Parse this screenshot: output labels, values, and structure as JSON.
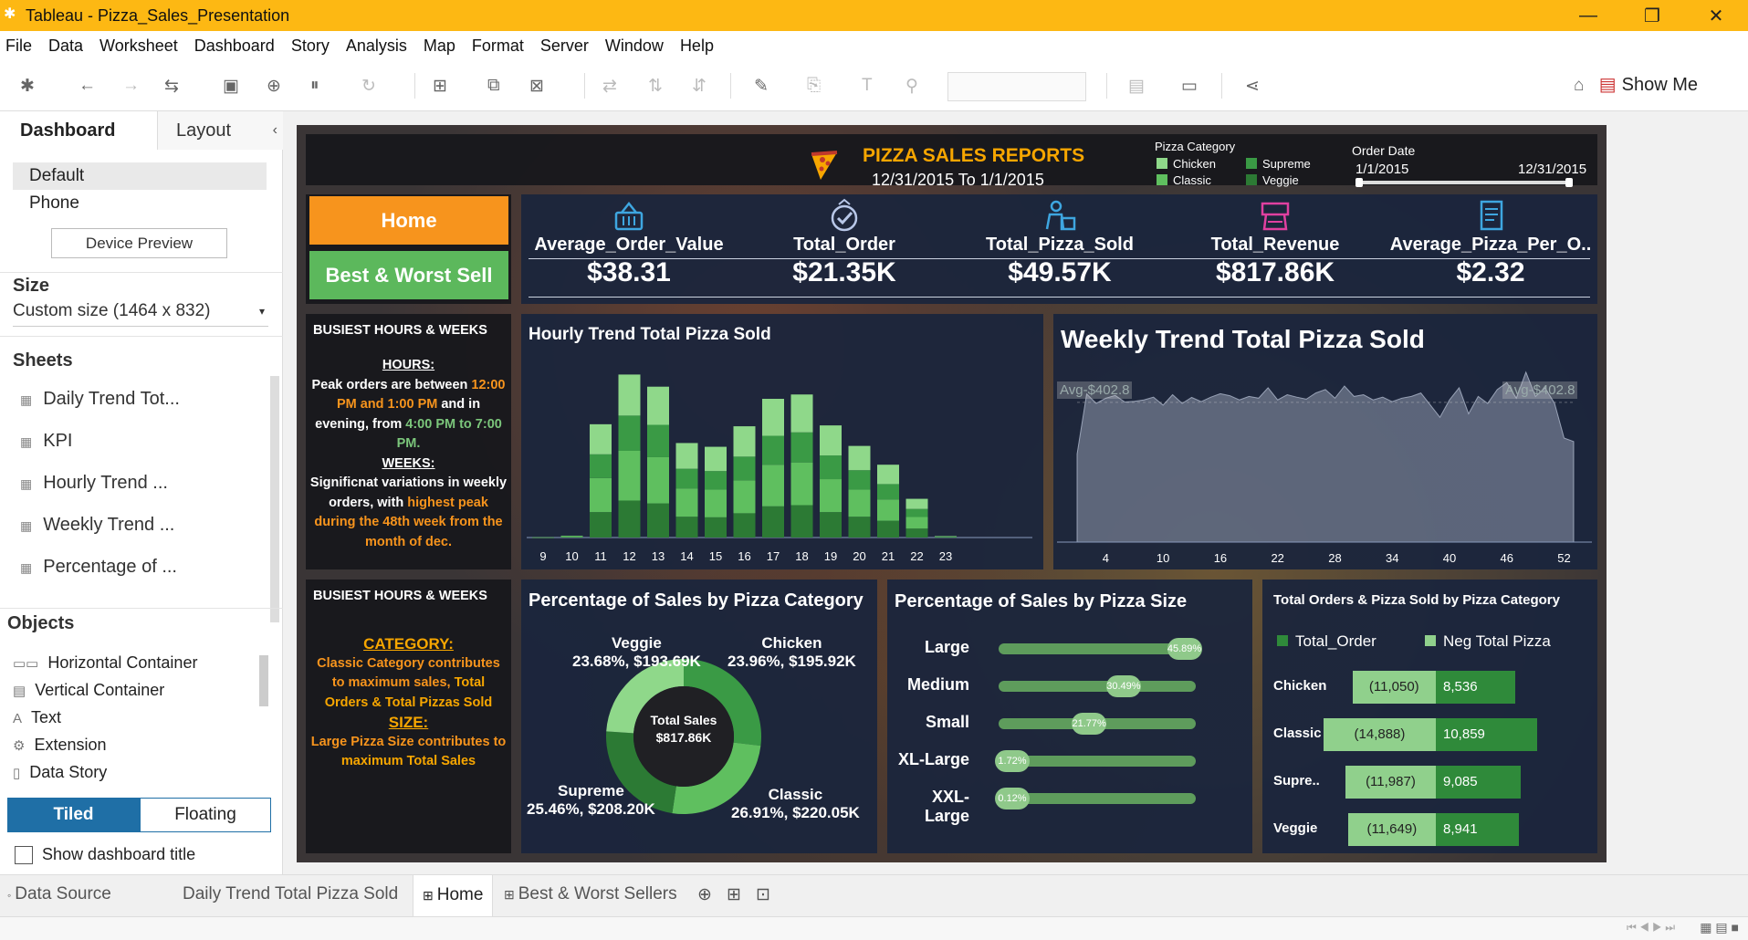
{
  "window": {
    "title": "Tableau - Pizza_Sales_Presentation"
  },
  "menu": [
    "File",
    "Data",
    "Worksheet",
    "Dashboard",
    "Story",
    "Analysis",
    "Map",
    "Format",
    "Server",
    "Window",
    "Help"
  ],
  "toolbar": {
    "show_me": "Show Me"
  },
  "left_panel": {
    "tabs": {
      "dashboard": "Dashboard",
      "layout": "Layout"
    },
    "devices": {
      "default": "Default",
      "phone": "Phone",
      "preview": "Device Preview"
    },
    "size": {
      "heading": "Size",
      "value": "Custom size (1464 x 832)"
    },
    "sheets": {
      "heading": "Sheets",
      "items": [
        "Daily Trend Tot...",
        "KPI",
        "Hourly Trend ...",
        "Weekly Trend ...",
        "Percentage of ..."
      ]
    },
    "objects": {
      "heading": "Objects",
      "items": [
        "Horizontal Container",
        "Vertical Container",
        "Text",
        "Extension",
        "Data Story"
      ]
    },
    "layout_mode": {
      "tiled": "Tiled",
      "floating": "Floating"
    },
    "show_title": "Show dashboard title"
  },
  "dashboard": {
    "header": {
      "title": "PIZZA SALES REPORTS",
      "subtitle": "12/31/2015 To 1/1/2015"
    },
    "category_legend": {
      "title": "Pizza Category",
      "items": [
        "Chicken",
        "Supreme",
        "Classic",
        "Veggie"
      ],
      "colors": [
        "#8fd88a",
        "#3a9a45",
        "#5fbf5f",
        "#2c7a34"
      ]
    },
    "order_date": {
      "title": "Order Date",
      "start": "1/1/2015",
      "end": "12/31/2015"
    },
    "nav": {
      "home": "Home",
      "best_worst": "Best & Worst Sell",
      "home_color": "#f7941d",
      "best_color": "#5cb85c"
    },
    "kpis": [
      {
        "label": "Average_Order_Value",
        "value": "$38.31",
        "icon": "shopping-basket-icon"
      },
      {
        "label": "Total_Order",
        "value": "$21.35K",
        "icon": "badge-check-icon"
      },
      {
        "label": "Total_Pizza_Sold",
        "value": "$49.57K",
        "icon": "delivery-person-icon"
      },
      {
        "label": "Total_Revenue",
        "value": "$817.86K",
        "icon": "register-icon"
      },
      {
        "label": "Average_Pizza_Per_O..",
        "value": "$2.32",
        "icon": "invoice-icon"
      }
    ],
    "note1": {
      "title": "BUSIEST HOURS & WEEKS",
      "hours_h": "HOURS:",
      "p1": "Peak orders are between",
      "p1b": "12:00 PM and 1:00 PM",
      "p1c": "and",
      "p2": "in evening, from",
      "p2b": "4:00 PM to 7:00 PM.",
      "weeks_h": "WEEKS:",
      "p3": "Significnat variations in weekly orders, with",
      "p3b": "highest peak during the 48th week from the month of dec."
    },
    "note2": {
      "title": "BUSIEST HOURS & WEEKS",
      "category_h": "CATEGORY:",
      "c1": "Classic Category contributes to maximum sales,",
      "c1b": "Total Orders & Total Pizzas Sold",
      "size_h": "SIZE:",
      "s1": "Large Pizza Size contributes to",
      "s1b": "maximum Total Sales"
    },
    "hourly_title": "Hourly Trend Total Pizza Sold",
    "weekly_title": "Weekly Trend Total Pizza Sold",
    "weekly_avg": "Avg-$402.8",
    "pie_title": "Percentage of Sales by Pizza Category",
    "pie_center": {
      "l1": "Total Sales",
      "l2": "$817.86K"
    },
    "pie_labels": [
      {
        "name": "Veggie",
        "value": "23.68%, $193.69K"
      },
      {
        "name": "Chicken",
        "value": "23.96%, $195.92K"
      },
      {
        "name": "Supreme",
        "value": "25.46%, $208.20K"
      },
      {
        "name": "Classic",
        "value": "26.91%, $220.05K"
      }
    ],
    "size_title": "Percentage of Sales by Pizza Size",
    "sizes": [
      {
        "name": "Large",
        "pct": 45.89,
        "label": "45.89%"
      },
      {
        "name": "Medium",
        "pct": 30.49,
        "label": "30.49%"
      },
      {
        "name": "Small",
        "pct": 21.77,
        "label": "21.77%"
      },
      {
        "name": "XL-Large",
        "pct": 1.72,
        "label": "1.72%"
      },
      {
        "name": "XXL-Large",
        "pct": 0.12,
        "label": "0.12%"
      }
    ],
    "orders_title": "Total Orders & Pizza Sold by Pizza Category",
    "orders_legend": {
      "a": "Total_Order",
      "b": "Neg Total Pizza"
    },
    "orders_rows": [
      {
        "name": "Chicken",
        "neg": "(11,050)",
        "pos": "8,536"
      },
      {
        "name": "Classic",
        "neg": "(14,888)",
        "pos": "10,859"
      },
      {
        "name": "Supre..",
        "neg": "(11,987)",
        "pos": "9,085"
      },
      {
        "name": "Veggie",
        "neg": "(11,649)",
        "pos": "8,941"
      }
    ]
  },
  "chart_data": [
    {
      "type": "bar",
      "title": "Hourly Trend Total Pizza Sold",
      "categories": [
        "9",
        "10",
        "11",
        "12",
        "13",
        "14",
        "15",
        "16",
        "17",
        "18",
        "19",
        "20",
        "21",
        "22",
        "23"
      ],
      "series": [
        {
          "name": "Chicken",
          "values": [
            1,
            8,
            520,
            710,
            660,
            445,
            420,
            525,
            640,
            655,
            520,
            420,
            335,
            175,
            6
          ]
        },
        {
          "name": "Supreme",
          "values": [
            0,
            6,
            410,
            610,
            560,
            340,
            320,
            410,
            500,
            520,
            410,
            335,
            265,
            140,
            5
          ]
        },
        {
          "name": "Classic",
          "values": [
            1,
            10,
            590,
            860,
            800,
            490,
            480,
            570,
            720,
            740,
            570,
            470,
            370,
            200,
            8
          ]
        },
        {
          "name": "Veggie",
          "values": [
            1,
            8,
            440,
            640,
            590,
            360,
            350,
            420,
            540,
            560,
            440,
            360,
            290,
            155,
            6
          ]
        }
      ]
    },
    {
      "type": "area",
      "title": "Weekly Trend Total Pizza Sold",
      "x": [
        1,
        2,
        3,
        4,
        5,
        6,
        7,
        8,
        9,
        10,
        11,
        12,
        13,
        14,
        15,
        16,
        17,
        18,
        19,
        20,
        21,
        22,
        23,
        24,
        25,
        26,
        27,
        28,
        29,
        30,
        31,
        32,
        33,
        34,
        35,
        36,
        37,
        38,
        39,
        40,
        41,
        42,
        43,
        44,
        45,
        46,
        47,
        48,
        49,
        50,
        51,
        52,
        53
      ],
      "values": [
        254,
        427,
        400,
        415,
        423,
        404,
        406,
        410,
        418,
        395,
        425,
        400,
        417,
        405,
        418,
        428,
        422,
        410,
        420,
        415,
        445,
        410,
        425,
        418,
        412,
        430,
        440,
        415,
        450,
        420,
        425,
        410,
        418,
        405,
        415,
        420,
        430,
        395,
        360,
        410,
        445,
        370,
        420,
        400,
        440,
        460,
        415,
        490,
        420,
        445,
        400,
        300,
        290
      ],
      "reference_line": {
        "label": "Avg-$402.8",
        "value": 402.8
      },
      "xticks": [
        "4",
        "10",
        "16",
        "22",
        "28",
        "34",
        "40",
        "46",
        "52"
      ]
    },
    {
      "type": "pie",
      "title": "Percentage of Sales by Pizza Category",
      "categories": [
        "Classic",
        "Supreme",
        "Veggie",
        "Chicken"
      ],
      "values": [
        26.91,
        25.46,
        23.68,
        23.96
      ]
    },
    {
      "type": "bar",
      "title": "Percentage of Sales by Pizza Size",
      "categories": [
        "Large",
        "Medium",
        "Small",
        "XL-Large",
        "XXL-Large"
      ],
      "values": [
        45.89,
        30.49,
        21.77,
        1.72,
        0.12
      ]
    },
    {
      "type": "bar",
      "title": "Total Orders & Pizza Sold by Pizza Category",
      "categories": [
        "Chicken",
        "Classic",
        "Supre..",
        "Veggie"
      ],
      "series": [
        {
          "name": "Total_Order",
          "values": [
            8536,
            10859,
            9085,
            8941
          ]
        },
        {
          "name": "Neg Total Pizza",
          "values": [
            -11050,
            -14888,
            -11987,
            -11649
          ]
        }
      ]
    }
  ],
  "bottom_tabs": {
    "data_source": "Data Source",
    "t1": "Daily Trend Total Pizza Sold",
    "t2": "Home",
    "t3": "Best & Worst Sellers"
  }
}
